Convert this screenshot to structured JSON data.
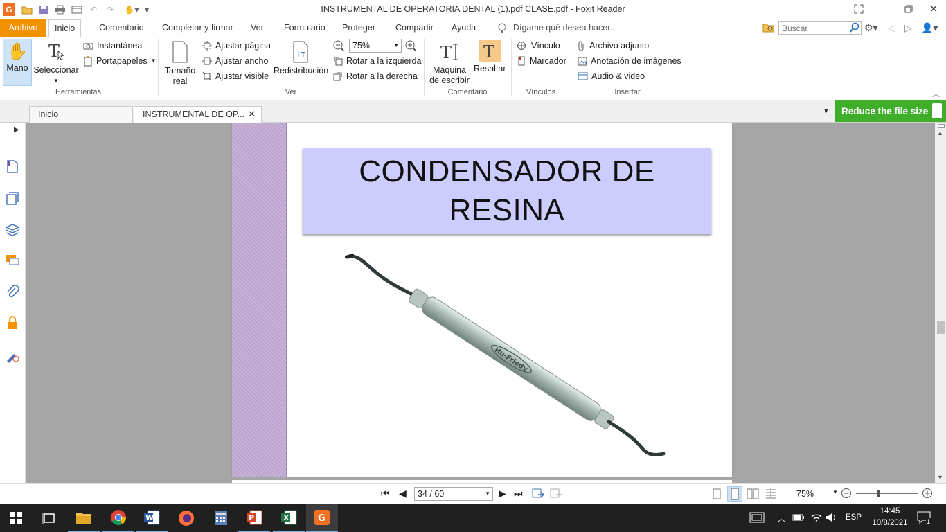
{
  "window": {
    "title": "INSTRUMENTAL DE OPERATORIA  DENTAL (1).pdf CLASE.pdf - Foxit Reader"
  },
  "menu": {
    "file": "Archivo",
    "items": [
      "Inicio",
      "Comentario",
      "Completar y firmar",
      "Ver",
      "Formulario",
      "Proteger",
      "Compartir",
      "Ayuda"
    ],
    "tell_me": "Dígame qué desea hacer...",
    "search_placeholder": "Buscar"
  },
  "ribbon": {
    "hand": "Mano",
    "select": "Seleccionar",
    "snapshot": "Instantánea",
    "clipboard": "Portapapeles",
    "group_tools": "Herramientas",
    "actual_size_1": "Tamaño",
    "actual_size_2": "real",
    "fit_page": "Ajustar página",
    "fit_width": "Ajustar ancho",
    "fit_visible": "Ajustar visible",
    "reflow": "Redistribución",
    "zoom": "75%",
    "rotate_left": "Rotar a la izquierda",
    "rotate_right": "Rotar a la derecha",
    "group_view": "Ver",
    "typewriter_1": "Máquina",
    "typewriter_2": "de escribir",
    "highlight": "Resaltar",
    "group_comment": "Comentario",
    "link": "Vínculo",
    "bookmark": "Marcador",
    "group_links": "Vínculos",
    "attachment": "Archivo adjunto",
    "image_annotation": "Anotación de imágenes",
    "audio_video": "Audio & video",
    "group_insert": "Insertar"
  },
  "tabs": {
    "home": "Inicio",
    "doc": "INSTRUMENTAL DE OP..."
  },
  "promo": "Reduce the file size",
  "document": {
    "title_line1": "CONDENSADOR DE",
    "title_line2": "RESINA",
    "brand_engraving": "Hu-Friedy"
  },
  "status": {
    "page": "34 / 60",
    "zoom": "75%"
  },
  "taskbar": {
    "lang": "ESP",
    "time": "14:45",
    "date": "10/8/2021",
    "notif": "1"
  }
}
